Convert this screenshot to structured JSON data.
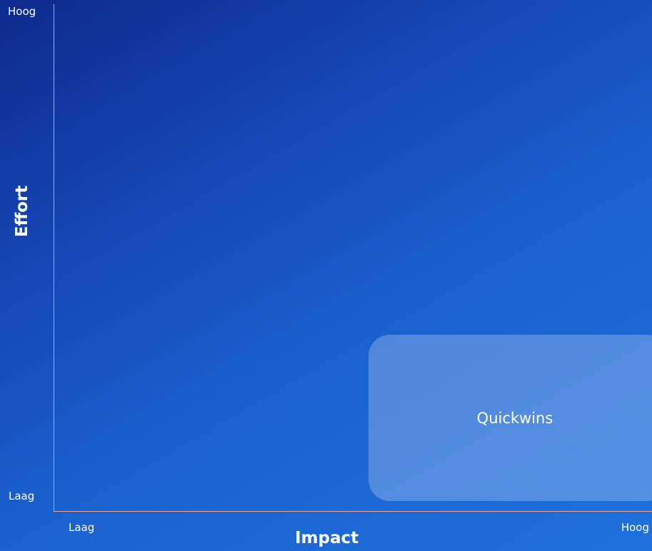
{
  "y_axis": {
    "title": "Effort",
    "high_label": "Hoog",
    "low_label": "Laag"
  },
  "x_axis": {
    "title": "Impact",
    "low_label": "Laag",
    "high_label": "Hoog"
  },
  "quadrants": [
    {
      "label": "Quickwins",
      "position": "bottom-right"
    }
  ],
  "colors": {
    "background_start": "#0d2a8c",
    "background_end": "#1f70de",
    "axis_line": "#e6a39a",
    "quadrant_fill": "rgba(255,255,255,0.24)",
    "text": "#ffffff"
  }
}
